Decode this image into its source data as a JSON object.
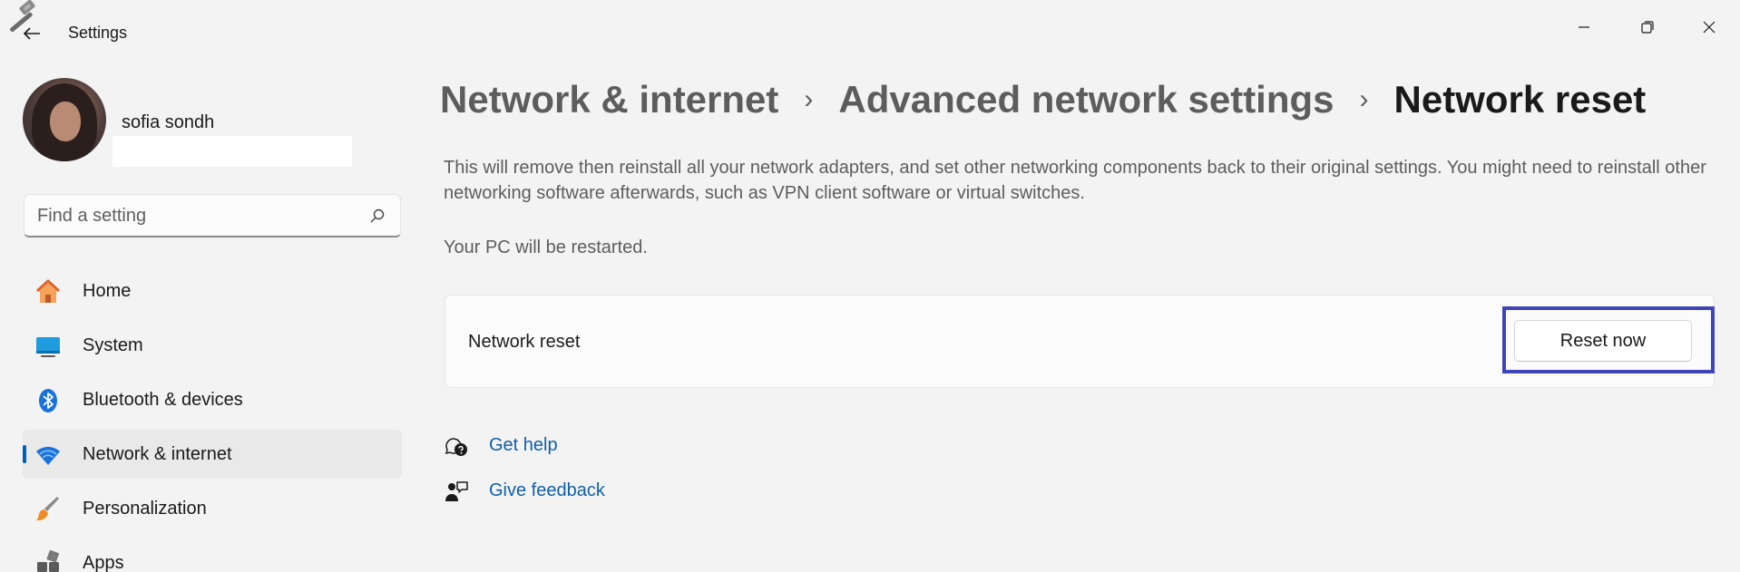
{
  "window": {
    "app_title": "Settings"
  },
  "user": {
    "name": "sofia sondh",
    "email": ""
  },
  "search": {
    "placeholder": "Find a setting"
  },
  "sidebar": {
    "items": [
      {
        "label": "Home",
        "icon": "home-icon",
        "active": false
      },
      {
        "label": "System",
        "icon": "system-display-icon",
        "active": false
      },
      {
        "label": "Bluetooth & devices",
        "icon": "bluetooth-icon",
        "active": false
      },
      {
        "label": "Network & internet",
        "icon": "wifi-icon",
        "active": true
      },
      {
        "label": "Personalization",
        "icon": "paintbrush-icon",
        "active": false
      },
      {
        "label": "Apps",
        "icon": "apps-icon",
        "active": false
      }
    ]
  },
  "breadcrumb": {
    "items": [
      "Network & internet",
      "Advanced network settings",
      "Network reset"
    ],
    "separator": "›"
  },
  "content": {
    "description": "This will remove then reinstall all your network adapters, and set other networking components back to their original settings. You might need to reinstall other networking software afterwards, such as VPN client software or virtual switches.",
    "restart_note": "Your PC will be restarted.",
    "card_label": "Network reset",
    "reset_button": "Reset now",
    "get_help": "Get help",
    "give_feedback": "Give feedback"
  },
  "colors": {
    "accent": "#005fb8",
    "link": "#0f5fa8",
    "highlight_box": "#3f44b8"
  }
}
